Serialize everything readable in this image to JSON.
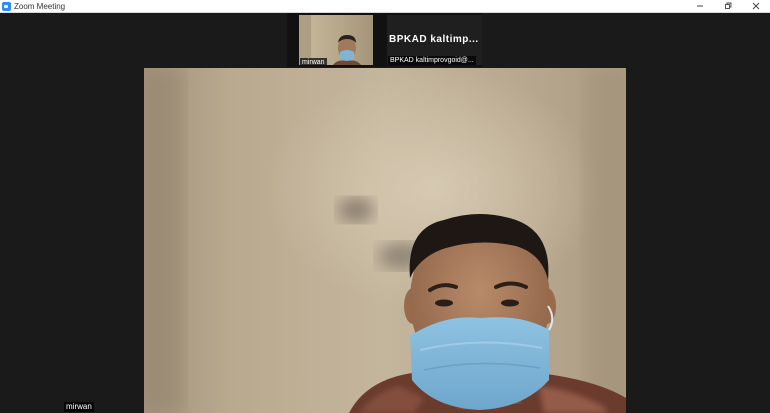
{
  "window": {
    "title": "Zoom Meeting",
    "controls": [
      {
        "name": "minimize",
        "icon": "minimize-icon"
      },
      {
        "name": "restore",
        "icon": "restore-icon"
      },
      {
        "name": "close",
        "icon": "close-icon"
      }
    ]
  },
  "gallery": {
    "tiles": [
      {
        "participant_name": "mirwan",
        "has_video": true
      },
      {
        "display_name": "BPKAD  kaltimp...",
        "participant_name": "BPKAD kaltimprovgoid@...",
        "has_video": false
      }
    ]
  },
  "active_speaker": {
    "participant_name": "mirwan",
    "has_video": true
  },
  "colors": {
    "window_background": "#1a1a1a",
    "titlebar_background": "#ffffff",
    "brand_blue": "#2d8cff",
    "mask_blue": "#7fb4d6"
  }
}
